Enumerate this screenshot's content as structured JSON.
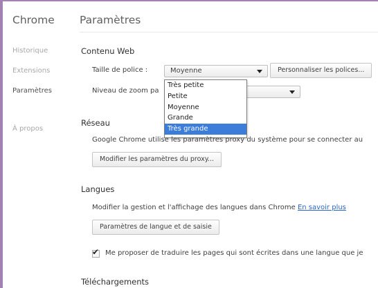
{
  "app": {
    "name": "Chrome"
  },
  "page": {
    "title": "Paramètres"
  },
  "sidebar": {
    "items": [
      {
        "label": "Historique"
      },
      {
        "label": "Extensions"
      },
      {
        "label": "Paramètres"
      },
      {
        "label": "À propos"
      }
    ]
  },
  "content_web": {
    "title": "Contenu Web",
    "font_size_label": "Taille de police :",
    "font_size_value": "Moyenne",
    "customize_fonts_button": "Personnaliser les polices...",
    "zoom_label": "Niveau de zoom pa",
    "font_size_options": [
      "Très petite",
      "Petite",
      "Moyenne",
      "Grande",
      "Très grande"
    ],
    "selected_option": "Très grande"
  },
  "network": {
    "title": "Réseau",
    "description": "Google Chrome utilise les paramètres proxy du système pour se connecter au",
    "proxy_button": "Modifier les paramètres du proxy..."
  },
  "languages": {
    "title": "Langues",
    "description": "Modifier la gestion et l'affichage des langues dans Chrome",
    "learn_more_link": "En savoir plus",
    "settings_button": "Paramètres de langue et de saisie",
    "translate_checkbox_label": "Me proposer de traduire les pages qui sont écrites dans une langue que je",
    "translate_checked": true
  },
  "downloads": {
    "title": "Téléchargements"
  },
  "colors": {
    "frame": "#a580b3",
    "highlight": "#3b7dd8",
    "link": "#2a66c9"
  }
}
